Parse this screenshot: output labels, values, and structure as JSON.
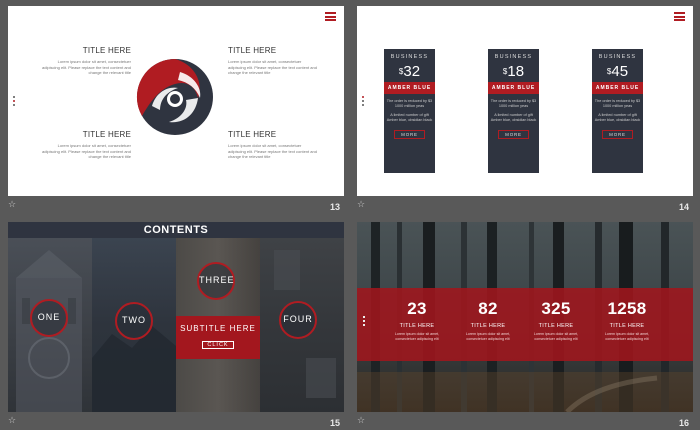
{
  "slides": [
    {
      "number": "13",
      "blocks": [
        {
          "title": "TITLE HERE",
          "text": "Lorem ipsum dolor sit amet, consectetuer adipiscing elit. Please replace the text content and change the relevant title"
        },
        {
          "title": "TITLE HERE",
          "text": "Lorem ipsum dolor sit amet, consectetuer adipiscing elit. Please replace the text content and change the relevant title"
        },
        {
          "title": "TITLE HERE",
          "text": "Lorem ipsum dolor sit amet, consectetuer adipiscing elit. Please replace the text content and change the relevant title"
        },
        {
          "title": "TITLE HERE",
          "text": "Lorem ipsum dolor sit amet, consectetuer adipiscing elit. Please replace the text content and change the relevant title"
        }
      ]
    },
    {
      "number": "14",
      "cards": [
        {
          "kicker": "BUSINESS",
          "currency": "$",
          "amount": "32",
          "band": "AMBER  BLUE",
          "features": [
            "The order is reduced by $3",
            "1000 million yeas",
            "A limited number of gift",
            "Amber blue, obsidian black"
          ],
          "cta": "MORE"
        },
        {
          "kicker": "BUSINESS",
          "currency": "$",
          "amount": "18",
          "band": "AMBER  BLUE",
          "features": [
            "The order is reduced by $3",
            "1000 million yeas",
            "A limited number of gift",
            "Amber blue, obsidian black"
          ],
          "cta": "MORE"
        },
        {
          "kicker": "BUSINESS",
          "currency": "$",
          "amount": "45",
          "band": "AMBER  BLUE",
          "features": [
            "The order is reduced by $3",
            "1000 million yeas",
            "A limited number of gift",
            "Amber blue, obsidian black"
          ],
          "cta": "MORE"
        }
      ]
    },
    {
      "number": "15",
      "heading": "CONTENTS",
      "rings": [
        "ONE",
        "TWO",
        "THREE",
        "FOUR"
      ],
      "subtitle": "SUBTITLE  HERE",
      "click": "CLICK"
    },
    {
      "number": "16",
      "stats": [
        {
          "value": "23",
          "label": "TITLE HERE",
          "text": "Lorem ipsum dolor sit amet, consectetuer adipiscing elit"
        },
        {
          "value": "82",
          "label": "TITLE HERE",
          "text": "Lorem ipsum dolor sit amet, consectetuer adipiscing elit"
        },
        {
          "value": "325",
          "label": "TITLE HERE",
          "text": "Lorem ipsum dolor sit amet, consectetuer adipiscing elit"
        },
        {
          "value": "1258",
          "label": "TITLE HERE",
          "text": "Lorem ipsum dolor sit amet, consectetuer adipiscing elit"
        }
      ]
    }
  ],
  "icons": {
    "star": "star-icon",
    "menu": "hamburger-menu-icon"
  },
  "colors": {
    "accent": "#b01c22",
    "dark": "#2f3440",
    "background": "#595959"
  }
}
